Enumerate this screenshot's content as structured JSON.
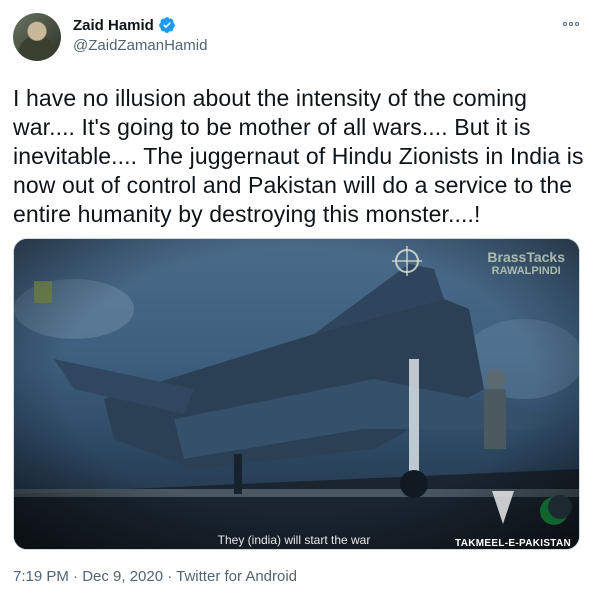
{
  "user": {
    "name": "Zaid Hamid",
    "handle": "@ZaidZamanHamid"
  },
  "tweet": {
    "text": "I have no illusion about the intensity of the coming war.... It's going to be mother of all wars.... But it is inevitable.... The juggernaut of Hindu Zionists in India is now out of control and Pakistan will do a service to the entire humanity by destroying this monster....!",
    "timestamp": "7:19 PM · Dec 9, 2020 · Twitter for Android"
  },
  "media": {
    "caption": "They (india) will start the war",
    "watermark_top": "BrassTacks",
    "watermark_sub": "RAWALPINDI",
    "watermark_bottom": "TAKMEEL-E-PAKISTAN"
  },
  "colors": {
    "verified": "#1d9bf0",
    "secondary_text": "#536471",
    "primary_text": "#0f1419"
  }
}
